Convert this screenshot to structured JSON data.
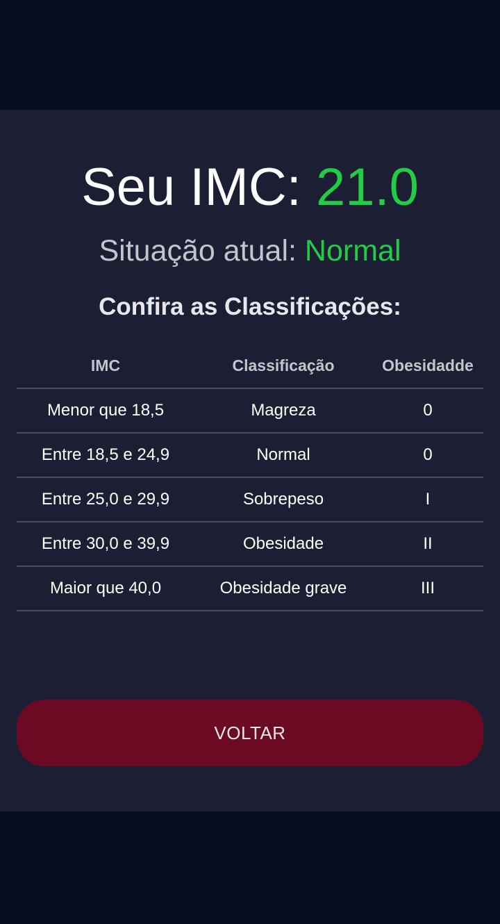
{
  "result": {
    "title_label": "Seu IMC:",
    "imc_value": "21.0",
    "situation_label": "Situação atual:",
    "situation_value": "Normal"
  },
  "table": {
    "heading": "Confira as Classificações:",
    "columns": [
      "IMC",
      "Classificação",
      "Obesidadde"
    ],
    "rows": [
      [
        "Menor que 18,5",
        "Magreza",
        "0"
      ],
      [
        "Entre 18,5 e 24,9",
        "Normal",
        "0"
      ],
      [
        "Entre 25,0 e 29,9",
        "Sobrepeso",
        "I"
      ],
      [
        "Entre 30,0 e 39,9",
        "Obesidade",
        "II"
      ],
      [
        "Maior que 40,0",
        "Obesidade grave",
        "III"
      ]
    ]
  },
  "actions": {
    "back_label": "VOLTAR"
  },
  "colors": {
    "background": "#080d22",
    "card": "#1c1f33",
    "accent_green": "#22cc44",
    "button": "#6b0a22"
  }
}
